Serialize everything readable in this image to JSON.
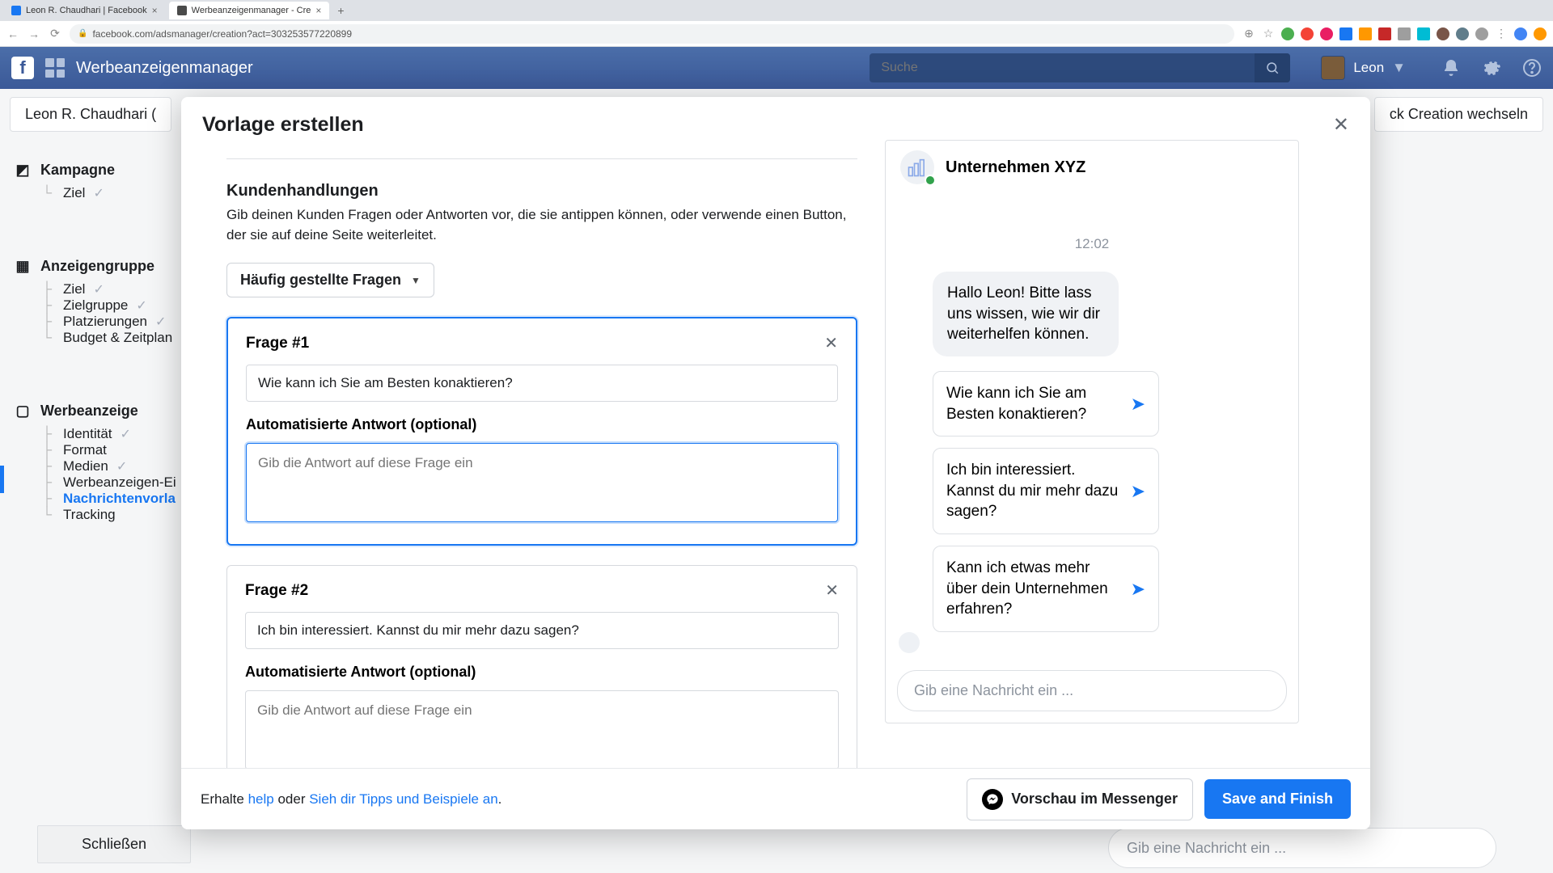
{
  "browser": {
    "tabs": [
      {
        "title": "Leon R. Chaudhari | Facebook",
        "active": false
      },
      {
        "title": "Werbeanzeigenmanager - Cre",
        "active": true
      }
    ],
    "url": "facebook.com/adsmanager/creation?act=3032535772208­99"
  },
  "topbar": {
    "app_title": "Werbeanzeigenmanager",
    "search_placeholder": "Suche",
    "user_name": "Leon"
  },
  "page": {
    "account_pill": "Leon R. Chaudhari (",
    "switch_pill": "ck Creation wechseln",
    "close_btn": "Schließen",
    "bg_msg_placeholder": "Gib eine Nachricht ein ..."
  },
  "rail": {
    "campaign": "Kampagne",
    "campaign_items": [
      "Ziel"
    ],
    "adset": "Anzeigengruppe",
    "adset_items": [
      "Ziel",
      "Zielgruppe",
      "Platzierungen",
      "Budget & Zeitplan"
    ],
    "ad": "Werbeanzeige",
    "ad_items": [
      "Identität",
      "Format",
      "Medien",
      "Werbeanzeigen-Ei",
      "Nachrichtenvorla",
      "Tracking"
    ]
  },
  "modal": {
    "title": "Vorlage erstellen",
    "section_title": "Kundenhandlungen",
    "section_desc": "Gib deinen Kunden Fragen oder Antworten vor, die sie antippen können, oder verwende einen Button, der sie auf deine Seite weiterleitet.",
    "dropdown": "Häufig gestellte Fragen",
    "questions": [
      {
        "label": "Frage #1",
        "text": "Wie kann ich Sie am Besten konaktieren?",
        "answer_label": "Automatisierte Antwort (optional)",
        "answer_placeholder": "Gib die Antwort auf diese Frage ein"
      },
      {
        "label": "Frage #2",
        "text": "Ich bin interessiert. Kannst du mir mehr dazu sagen?",
        "answer_label": "Automatisierte Antwort (optional)",
        "answer_placeholder": "Gib die Antwort auf diese Frage ein"
      }
    ],
    "footer": {
      "help_pre": "Erhalte ",
      "help_link1": "help",
      "help_mid": " oder ",
      "help_link2": "Sieh dir Tipps und Beispiele an",
      "help_post": ".",
      "preview_btn": "Vorschau im Messenger",
      "save_btn": "Save and Finish"
    }
  },
  "preview": {
    "page_name": "Unternehmen XYZ",
    "time": "12:02",
    "greeting": "Hallo Leon! Bitte lass uns wissen, wie wir dir weiterhelfen können.",
    "quick_replies": [
      "Wie kann ich Sie am Besten konaktieren?",
      "Ich bin interessiert. Kannst du mir mehr dazu sagen?",
      "Kann ich etwas mehr über dein Unternehmen erfahren?"
    ],
    "input_placeholder": "Gib eine Nachricht ein ..."
  }
}
